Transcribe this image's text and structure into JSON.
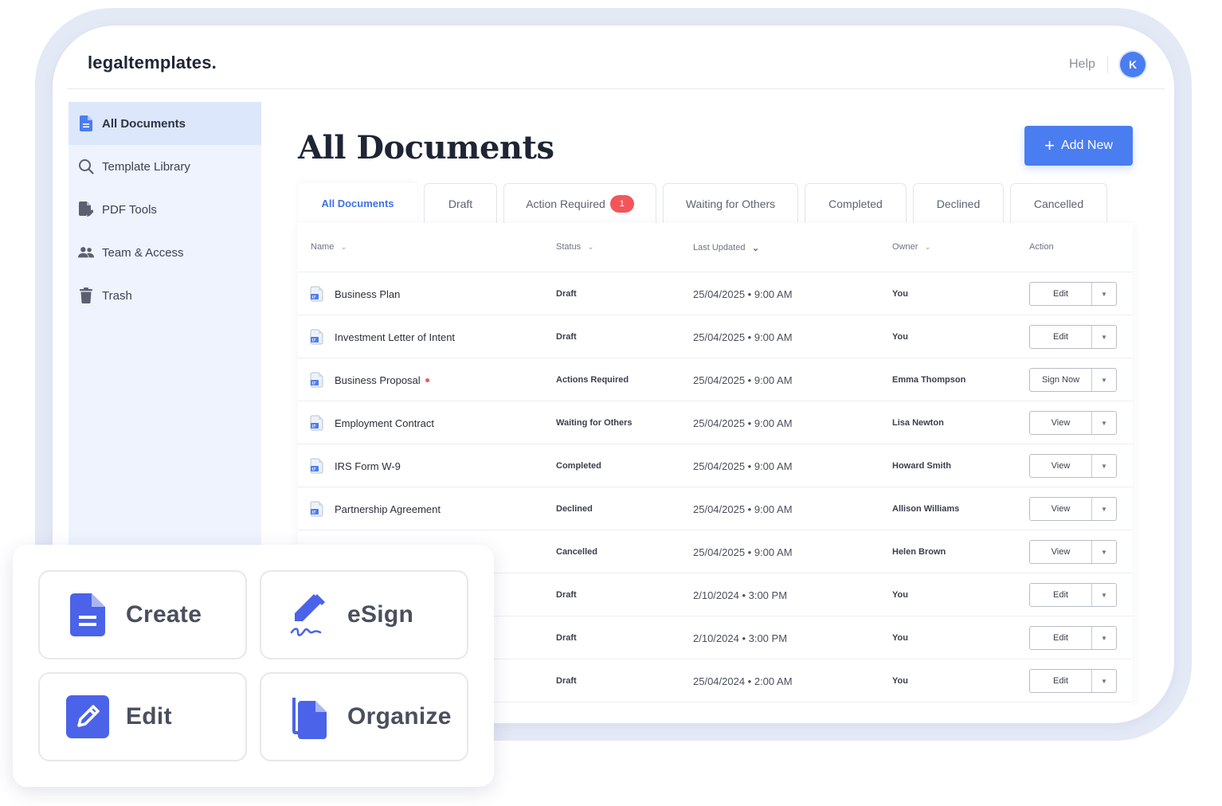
{
  "header": {
    "logo": "legaltemplates.",
    "help": "Help",
    "avatar_initial": "K"
  },
  "sidebar": {
    "items": [
      {
        "label": "All Documents",
        "icon": "document-icon"
      },
      {
        "label": "Template Library",
        "icon": "search-icon"
      },
      {
        "label": "PDF Tools",
        "icon": "pdf-edit-icon"
      },
      {
        "label": "Team & Access",
        "icon": "team-icon"
      },
      {
        "label": "Trash",
        "icon": "trash-icon"
      }
    ]
  },
  "main": {
    "title": "All Documents",
    "add_new": "Add New",
    "tabs": [
      {
        "label": "All Documents"
      },
      {
        "label": "Draft"
      },
      {
        "label": "Action Required",
        "badge": "1"
      },
      {
        "label": "Waiting for Others"
      },
      {
        "label": "Completed"
      },
      {
        "label": "Declined"
      },
      {
        "label": "Cancelled"
      }
    ],
    "columns": [
      "Name",
      "Status",
      "Last Updated",
      "Owner",
      "Action"
    ],
    "rows": [
      {
        "name": "Business Plan",
        "status": "Draft",
        "updated": "25/04/2025 • 9:00 AM",
        "owner": "You",
        "action": "Edit"
      },
      {
        "name": "Investment Letter of Intent",
        "status": "Draft",
        "updated": "25/04/2025 • 9:00 AM",
        "owner": "You",
        "action": "Edit"
      },
      {
        "name": "Business Proposal",
        "status": "Actions Required",
        "updated": "25/04/2025 • 9:00 AM",
        "owner": "Emma Thompson",
        "action": "Sign Now"
      },
      {
        "name": "Employment Contract",
        "status": "Waiting for Others",
        "updated": "25/04/2025 • 9:00 AM",
        "owner": "Lisa Newton",
        "action": "View"
      },
      {
        "name": "IRS Form W-9",
        "status": "Completed",
        "updated": "25/04/2025 • 9:00 AM",
        "owner": "Howard Smith",
        "action": "View"
      },
      {
        "name": "Partnership Agreement",
        "status": "Declined",
        "updated": "25/04/2025 • 9:00 AM",
        "owner": "Allison Williams",
        "action": "View"
      },
      {
        "name": "",
        "status": "Cancelled",
        "updated": "25/04/2025 • 9:00 AM",
        "owner": "Helen Brown",
        "action": "View"
      },
      {
        "name": "",
        "status": "Draft",
        "updated": "2/10/2024 • 3:00 PM",
        "owner": "You",
        "action": "Edit"
      },
      {
        "name": "",
        "status": "Draft",
        "updated": "2/10/2024 • 3:00 PM",
        "owner": "You",
        "action": "Edit"
      },
      {
        "name": "",
        "status": "Draft",
        "updated": "25/04/2024 • 2:00 AM",
        "owner": "You",
        "action": "Edit"
      }
    ]
  },
  "features": [
    {
      "label": "Create",
      "icon": "document-icon"
    },
    {
      "label": "eSign",
      "icon": "pen-signature-icon"
    },
    {
      "label": "Edit",
      "icon": "pencil-icon"
    },
    {
      "label": "Organize",
      "icon": "copy-documents-icon"
    }
  ],
  "colors": {
    "accent": "#4a7df0",
    "badge": "#f2565a",
    "sidebar_bg": "#eef3fd",
    "frame": "#e4e9f6"
  }
}
